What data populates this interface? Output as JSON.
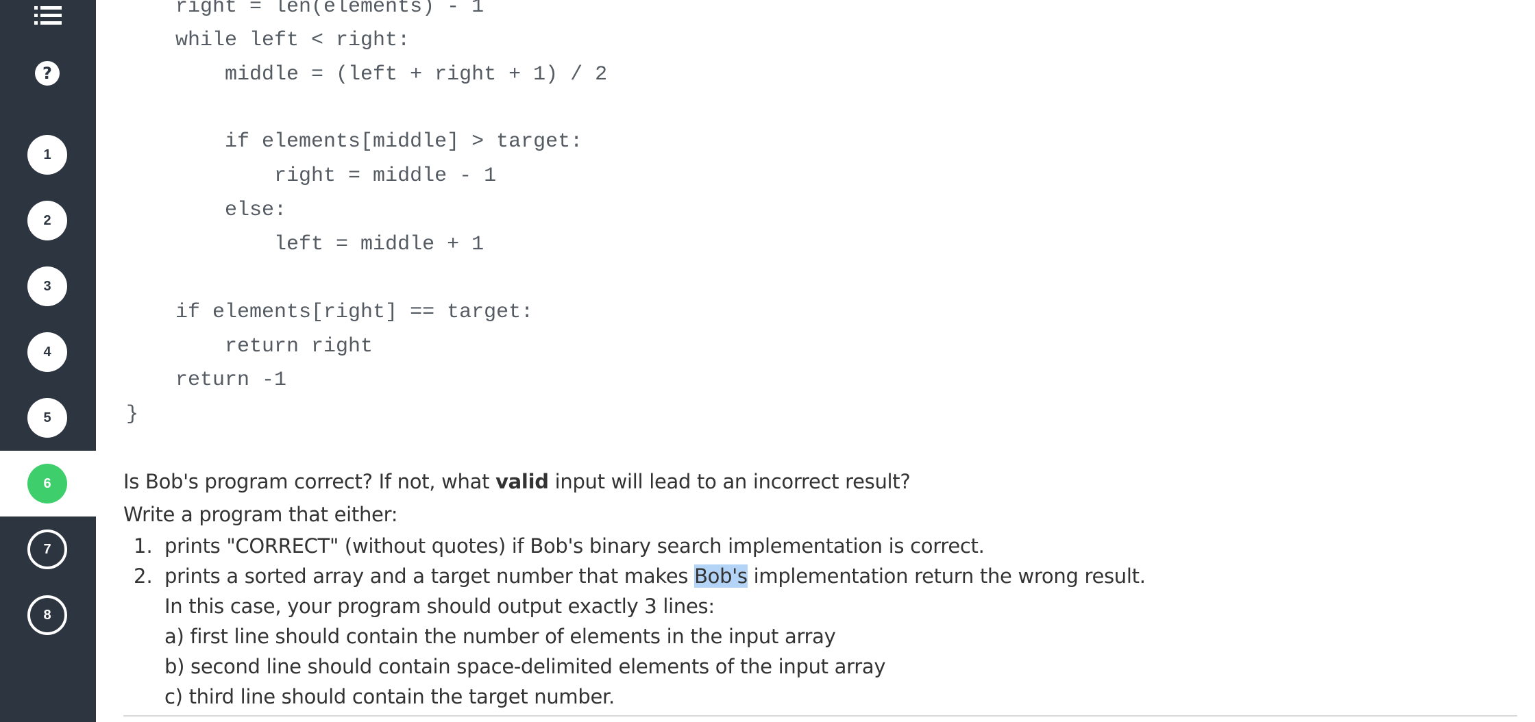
{
  "sidebar": {
    "menu_icon": "list-icon",
    "help_icon_glyph": "?",
    "questions": [
      {
        "label": "1",
        "state": "done"
      },
      {
        "label": "2",
        "state": "done"
      },
      {
        "label": "3",
        "state": "done"
      },
      {
        "label": "4",
        "state": "done"
      },
      {
        "label": "5",
        "state": "done"
      },
      {
        "label": "6",
        "state": "current"
      },
      {
        "label": "7",
        "state": "todo"
      },
      {
        "label": "8",
        "state": "todo"
      }
    ],
    "colors": {
      "background": "#2d3540",
      "current": "#3ecf6c"
    }
  },
  "code": {
    "lines": [
      "    right = len(elements) - 1",
      "    while left < right:",
      "        middle = (left + right + 1) / 2",
      "",
      "        if elements[middle] > target:",
      "            right = middle - 1",
      "        else:",
      "            left = middle + 1",
      "",
      "    if elements[right] == target:",
      "        return right",
      "    return -1",
      "}"
    ]
  },
  "question": {
    "prefix": "Is Bob's program correct? If not, what ",
    "bold": "valid",
    "suffix": " input will lead to an incorrect result?",
    "instruction": "Write a program that either:",
    "items": [
      {
        "num": "1.",
        "text": "prints \"CORRECT\" (without quotes) if Bob's binary search implementation is correct."
      },
      {
        "num": "2.",
        "pre": "prints a sorted array and a target number that makes ",
        "highlight": "Bob's",
        "post": " implementation return the wrong result."
      }
    ],
    "details": [
      "In this case, your program should output exactly 3 lines:",
      "a) first line should contain the number of elements in the input array",
      "b) second line should contain space-delimited elements of the input array",
      "c) third line should contain the target number."
    ]
  }
}
